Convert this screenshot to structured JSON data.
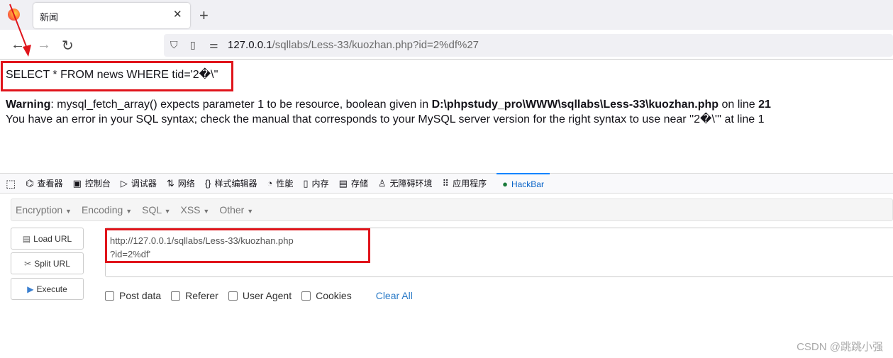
{
  "browser": {
    "tab_title": "新闻",
    "url_host": "127.0.0.1",
    "url_path": "/sqllabs/Less-33/kuozhan.php?id=2%df%27"
  },
  "page": {
    "sql": "SELECT * FROM news WHERE tid='2�\\''",
    "warning_label": "Warning",
    "warning_text": ": mysql_fetch_array() expects parameter 1 to be resource, boolean given in ",
    "warning_path": "D:\\phpstudy_pro\\WWW\\sqllabs\\Less-33\\kuozhan.php",
    "warning_online": " on line ",
    "warning_line": "21",
    "error": "You have an error in your SQL syntax; check the manual that corresponds to your MySQL server version for the right syntax to use near ''2�\\''' at line 1"
  },
  "devtools": {
    "tabs": [
      {
        "label": "查看器",
        "icon": "⌬"
      },
      {
        "label": "控制台",
        "icon": "▣"
      },
      {
        "label": "调试器",
        "icon": "▷"
      },
      {
        "label": "网络",
        "icon": "⇅"
      },
      {
        "label": "样式编辑器",
        "icon": "{}"
      },
      {
        "label": "性能",
        "icon": "◔"
      },
      {
        "label": "内存",
        "icon": "▯"
      },
      {
        "label": "存储",
        "icon": "▤"
      },
      {
        "label": "无障碍环境",
        "icon": "♙"
      },
      {
        "label": "应用程序",
        "icon": "⠿"
      },
      {
        "label": "HackBar",
        "icon": "●"
      }
    ]
  },
  "hackbar": {
    "menus": [
      "Encryption",
      "Encoding",
      "SQL",
      "XSS",
      "Other"
    ],
    "buttons": {
      "load": "Load URL",
      "split": "Split URL",
      "execute": "Execute"
    },
    "url_line1": "http://127.0.0.1/sqllabs/Less-33/kuozhan.php",
    "url_line2": "?id=2%df'",
    "options": [
      "Post data",
      "Referer",
      "User Agent",
      "Cookies"
    ],
    "clear_all": "Clear All"
  },
  "watermark": "CSDN @跳跳小强",
  "colors": {
    "highlight": "#e0141b",
    "accent": "#0a84ff"
  }
}
